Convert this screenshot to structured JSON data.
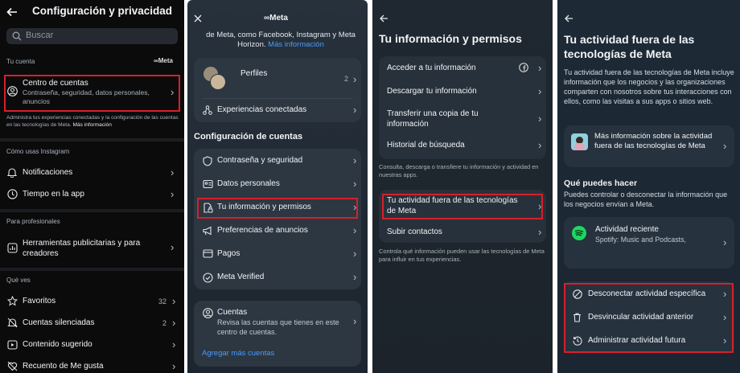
{
  "p1": {
    "title": "Configuración y privacidad",
    "search_placeholder": "Buscar",
    "section_account": "Tu cuenta",
    "meta_badge": "∞Meta",
    "accounts_center": {
      "title": "Centro de cuentas",
      "subtitle": "Contraseña, seguridad, datos personales, anuncios"
    },
    "accounts_note": "Administra tus experiencias conectadas y la configuración de las cuentas en las tecnologías de Meta.",
    "accounts_note_link": "Más información",
    "section_usage": "Cómo usas Instagram",
    "notifications": "Notificaciones",
    "time_in_app": "Tiempo en la app",
    "section_pro": "Para profesionales",
    "ad_tools": "Herramientas publicitarias y para creadores",
    "section_see": "Qué ves",
    "favorites": "Favoritos",
    "favorites_count": "32",
    "muted": "Cuentas silenciadas",
    "muted_count": "2",
    "suggested": "Contenido sugerido",
    "likes": "Recuento de Me gusta"
  },
  "p2": {
    "meta_title": "∞Meta",
    "intro": "de Meta, como Facebook, Instagram y Meta Horizon.",
    "intro_link": "Más información",
    "profiles": "Perfiles",
    "profiles_count": "2",
    "connected": "Experiencias conectadas",
    "section_config": "Configuración de cuentas",
    "password": "Contraseña y seguridad",
    "personal": "Datos personales",
    "info": "Tu información y permisos",
    "ads_prefs": "Preferencias de anuncios",
    "payments": "Pagos",
    "verified": "Meta Verified",
    "accounts_title": "Cuentas",
    "accounts_desc": "Revisa las cuentas que tienes en este centro de cuentas.",
    "add_accounts": "Agregar más cuentas"
  },
  "p3": {
    "title": "Tu información y permisos",
    "access": "Acceder a tu información",
    "download": "Descargar tu información",
    "transfer": "Transferir una copia de tu información",
    "history": "Historial de búsqueda",
    "note1": "Consulta, descarga o transfiere tu información y actividad en nuestras apps.",
    "off_meta": "Tu actividad fuera de las tecnologías de Meta",
    "upload": "Subir contactos",
    "note2": "Controla qué información pueden usar las tecnologías de Meta para influir en tus experiencias."
  },
  "p4": {
    "title": "Tu actividad fuera de las tecnologías de Meta",
    "desc": "Tu actividad fuera de las tecnologías de Meta incluye información que los negocios y las organizaciones comparten con nosotros sobre tus interacciones con ellos, como las visitas a sus apps o sitios web.",
    "more_info": "Más información sobre la actividad fuera de las tecnologías de Meta",
    "what_title": "Qué puedes hacer",
    "what_desc": "Puedes controlar o desconectar la información que los negocios envían a Meta.",
    "recent_title": "Actividad reciente",
    "recent_sub": "Spotify: Music and Podcasts,",
    "disconnect": "Desconectar actividad específica",
    "unlink": "Desvincular actividad anterior",
    "manage": "Administrar actividad futura"
  },
  "colors": {
    "highlight": "#d6202b",
    "link": "#4a9bff"
  }
}
